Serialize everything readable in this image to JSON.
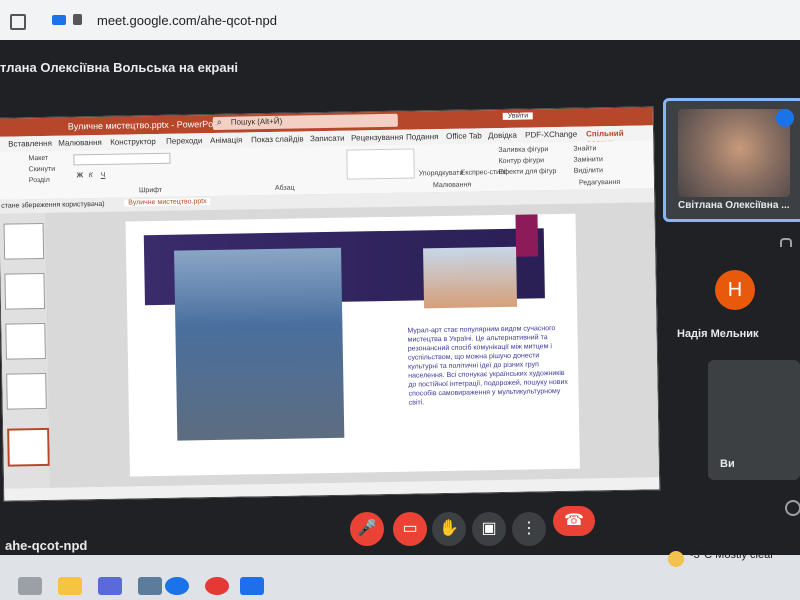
{
  "browser": {
    "url": "meet.google.com/ahe-qcot-npd"
  },
  "meet": {
    "presenting_label": "тлана Олексіївна Вольська на екрані",
    "meeting_code": "ahe-qcot-npd",
    "participants": [
      {
        "name": "Світлана Олексіївна ..."
      },
      {
        "name": "Надія Мельник",
        "initial": "Н"
      },
      {
        "name": "Ви"
      }
    ]
  },
  "powerpoint": {
    "window_title": "Вуличне мистецтво.pptx - PowerPoint",
    "search_placeholder": "Пошук (Alt+Й)",
    "signin": "Увійти",
    "tabs": [
      "Вставлення",
      "Малювання",
      "Конструктор",
      "Переходи",
      "Анімація",
      "Показ слайдів",
      "Записати",
      "Рецензування",
      "Подання",
      "Office Tab",
      "Довідка",
      "PDF-XChange",
      "Спільний доступ"
    ],
    "ribbon_groups": [
      "Шрифт",
      "Абзац",
      "Малювання",
      "Редагування"
    ],
    "ribbon_buttons": [
      "Макет",
      "Скинути",
      "Розділ",
      "Упорядкувати",
      "Експрес-стилі",
      "Заливка фігури",
      "Контур фігури",
      "Ефекти для фігур",
      "Знайти",
      "Замінити",
      "Виділити"
    ],
    "file_tabs": [
      "стане збереження користувача)",
      "Вуличне мистецтво.pptx"
    ],
    "slide_text": "Мурал-арт стає популярним видом сучасного мистецтва в Україні. Це альтернативний та резонансний спосіб комунікації між митцем і суспільством, що можна рішучо донести культурні та політичні ідеї до різних груп населення. Всі спонукає українських художників до постійної інтеграції, подорожей, пошуку нових способів самовираження у мультикультурному світі."
  },
  "taskbar": {
    "weather": "-3°C  Mostly clear"
  },
  "colors": {
    "meet_bg": "#202124",
    "leave_button": "#ea4335",
    "active_speaker_border": "#8ab4f8",
    "powerpoint_red": "#b7472a"
  }
}
